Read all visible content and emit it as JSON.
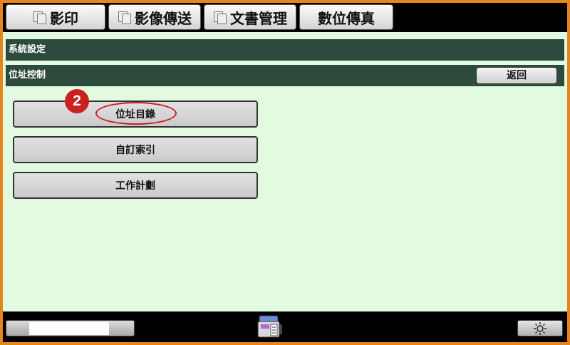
{
  "tabs": [
    {
      "label": "影印",
      "icon": "copy-icon"
    },
    {
      "label": "影像傳送",
      "icon": "image-send-icon"
    },
    {
      "label": "文書管理",
      "icon": "document-filing-icon"
    },
    {
      "label": "數位傳真",
      "icon": ""
    }
  ],
  "breadcrumb": {
    "system_settings": "系統設定",
    "address_control": "位址控制",
    "back_label": "返回"
  },
  "menu": {
    "items": [
      {
        "label": "位址目錄"
      },
      {
        "label": "自訂索引"
      },
      {
        "label": "工作計劃"
      }
    ]
  },
  "annotation": {
    "step_number": "2",
    "highlight_color": "#c81e1e"
  },
  "colors": {
    "frame": "#e8841c",
    "header_bar": "#2d4a3e",
    "content_bg": "#e2fadf"
  },
  "footer": {
    "device_icon": "printer-status-icon",
    "brightness_icon": "brightness-icon"
  }
}
